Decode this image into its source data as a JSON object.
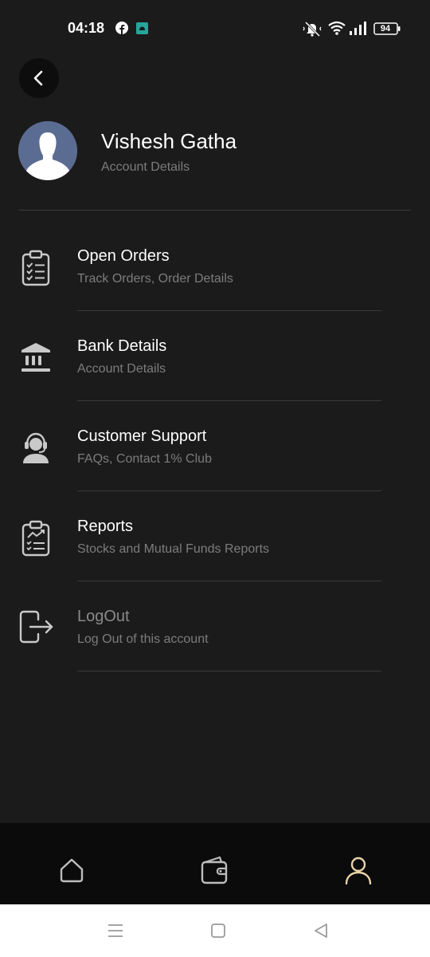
{
  "status_bar": {
    "time": "04:18",
    "battery": "94",
    "icons": [
      "facebook-icon",
      "app-notification-icon",
      "mute-icon",
      "wifi-icon",
      "signal-icon",
      "battery-icon"
    ]
  },
  "profile": {
    "name": "Vishesh Gatha",
    "subtitle": "Account Details"
  },
  "menu": {
    "items": [
      {
        "title": "Open Orders",
        "subtitle": "Track Orders, Order Details",
        "icon": "clipboard-checklist-icon"
      },
      {
        "title": "Bank Details",
        "subtitle": "Account Details",
        "icon": "bank-icon"
      },
      {
        "title": "Customer Support",
        "subtitle": "FAQs, Contact 1% Club",
        "icon": "headset-support-icon"
      },
      {
        "title": "Reports",
        "subtitle": "Stocks and Mutual Funds Reports",
        "icon": "report-clipboard-icon"
      },
      {
        "title": "LogOut",
        "subtitle": "Log Out of this account",
        "icon": "logout-icon"
      }
    ]
  },
  "bottom_nav": {
    "items": [
      "home-icon",
      "wallet-icon",
      "profile-icon"
    ],
    "active": "profile-icon",
    "active_color": "#e8d3a6"
  },
  "colors": {
    "background": "#1b1b1b",
    "text_primary": "#ffffff",
    "text_secondary": "#7c7c7c",
    "divider": "#3a3a3a",
    "nav_background": "#0b0b0b"
  }
}
